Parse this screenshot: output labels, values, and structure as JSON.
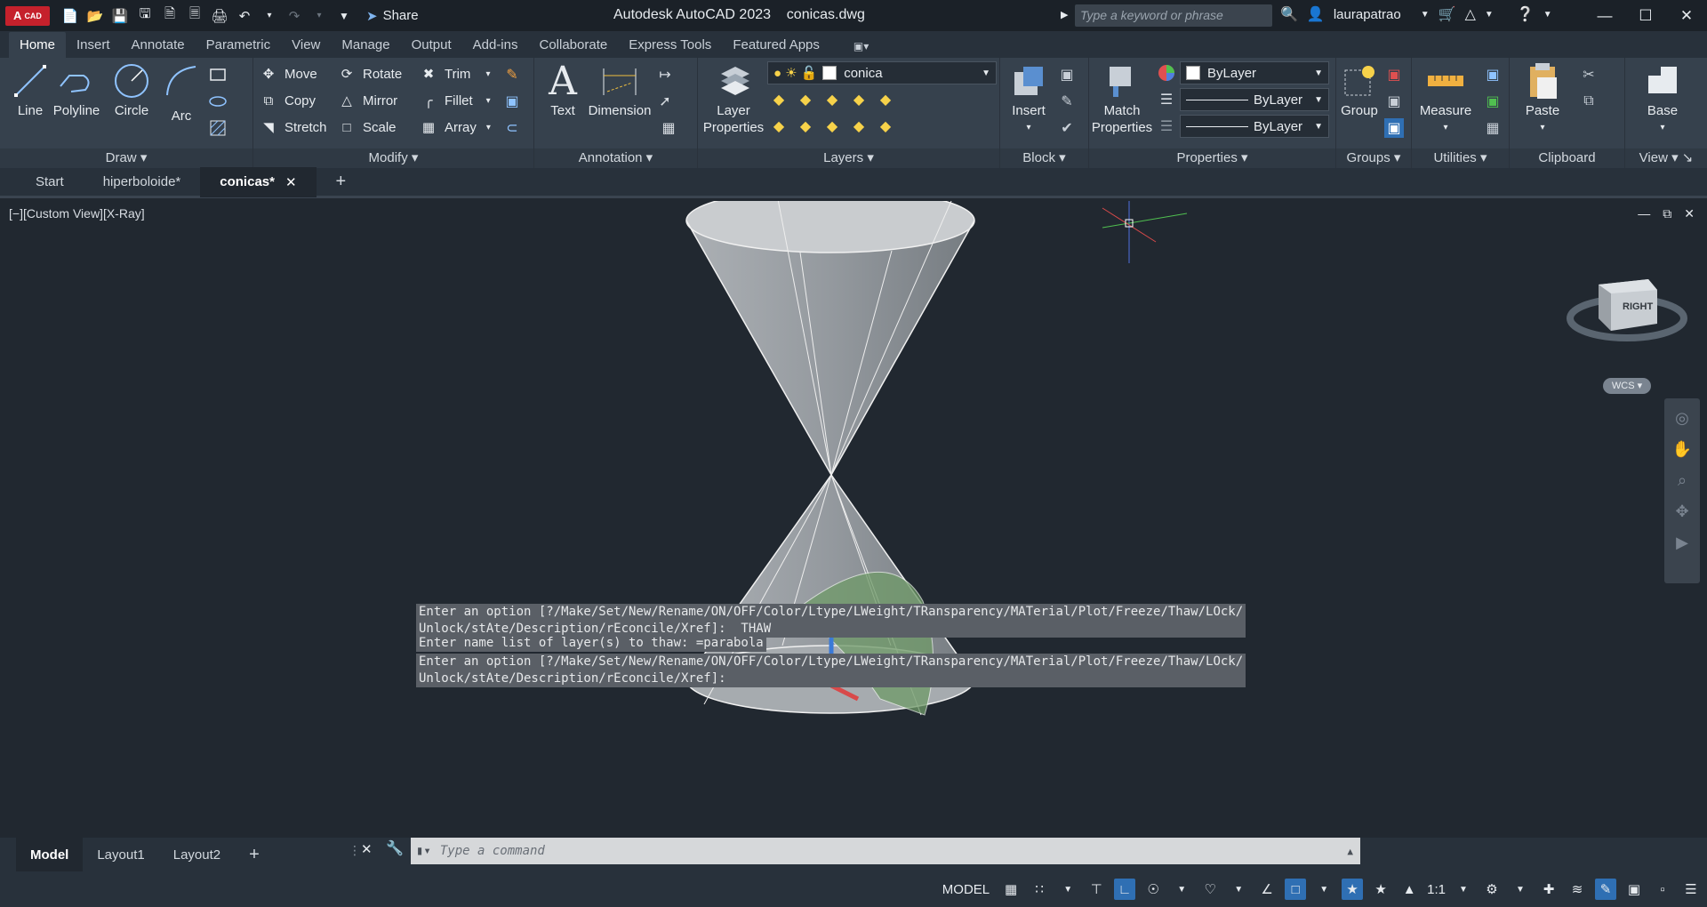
{
  "app": {
    "logo_text": "A",
    "logo_sub": "CAD",
    "title": "Autodesk AutoCAD 2023    conicas.dwg",
    "share_label": "Share",
    "search_placeholder": "Type a keyword or phrase",
    "username": "laurapatrao"
  },
  "ribbon_tabs": [
    "Home",
    "Insert",
    "Annotate",
    "Parametric",
    "View",
    "Manage",
    "Output",
    "Add-ins",
    "Collaborate",
    "Express Tools",
    "Featured Apps"
  ],
  "ribbon": {
    "draw": {
      "title": "Draw",
      "line": "Line",
      "polyline": "Polyline",
      "circle": "Circle",
      "arc": "Arc"
    },
    "modify": {
      "title": "Modify",
      "move": "Move",
      "rotate": "Rotate",
      "trim": "Trim",
      "copy": "Copy",
      "mirror": "Mirror",
      "fillet": "Fillet",
      "stretch": "Stretch",
      "scale": "Scale",
      "array": "Array"
    },
    "annotation": {
      "title": "Annotation",
      "text": "Text",
      "dimension": "Dimension"
    },
    "layers": {
      "title": "Layers",
      "layer_props_1": "Layer",
      "layer_props_2": "Properties",
      "current_layer": "conica"
    },
    "block": {
      "title": "Block",
      "insert": "Insert"
    },
    "properties": {
      "title": "Properties",
      "match_1": "Match",
      "match_2": "Properties",
      "color": "ByLayer",
      "linetype": "ByLayer",
      "lineweight": "ByLayer"
    },
    "groups": {
      "title": "Groups",
      "group": "Group"
    },
    "utilities": {
      "title": "Utilities",
      "measure": "Measure"
    },
    "clipboard": {
      "title": "Clipboard",
      "paste": "Paste"
    },
    "view": {
      "title": "View",
      "base": "Base"
    }
  },
  "doc_tabs": [
    "Start",
    "hiperboloide*",
    "conicas*"
  ],
  "viewport": {
    "label": "[−][Custom View][X-Ray]",
    "viewcube_face": "RIGHT",
    "wcs_label": "WCS"
  },
  "command_history": [
    "Enter an option [?/Make/Set/New/Rename/ON/OFF/Color/Ltype/LWeight/TRansparency/MATerial/Plot/Freeze/Thaw/LOck/\nUnlock/stAte/Description/rEconcile/Xref]: _THAW",
    "Enter name list of layer(s) to thaw: =parabola",
    "Enter an option [?/Make/Set/New/Rename/ON/OFF/Color/Ltype/LWeight/TRansparency/MATerial/Plot/Freeze/Thaw/LOck/\nUnlock/stAte/Description/rEconcile/Xref]:"
  ],
  "command_placeholder": "Type a command",
  "layout_tabs": [
    "Model",
    "Layout1",
    "Layout2"
  ],
  "status": {
    "model": "MODEL",
    "scale": "1:1"
  }
}
